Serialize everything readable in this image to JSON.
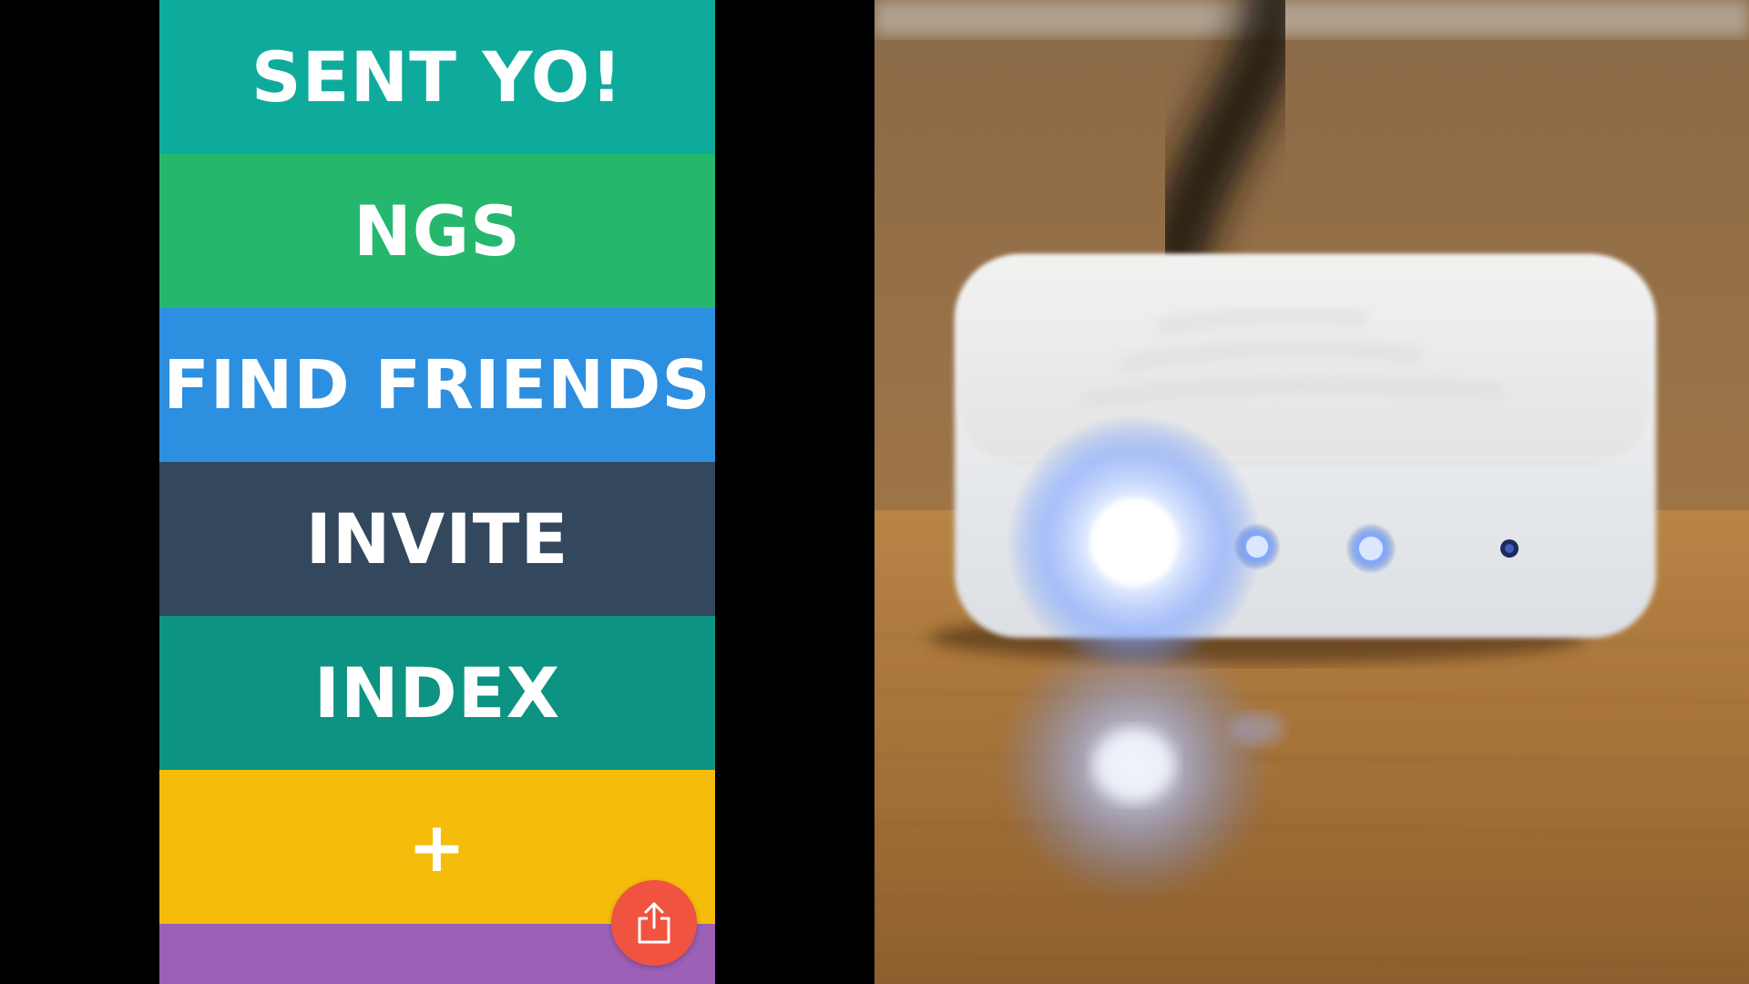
{
  "app": {
    "rows": [
      {
        "label": "SENT YO!",
        "color": "#0eab9c"
      },
      {
        "label": "NGS",
        "color": "#25b86d"
      },
      {
        "label": "FIND FRIENDS",
        "color": "#2c8fe0"
      },
      {
        "label": "INVITE",
        "color": "#33475d"
      },
      {
        "label": "INDEX",
        "color": "#0d9381"
      },
      {
        "label": "+",
        "color": "#f6bc0b"
      },
      {
        "label": "",
        "color": "#9c60b6"
      }
    ],
    "share_button": {
      "icon": "share-icon",
      "color": "#f0533f"
    }
  },
  "photo": {
    "subject": "white-device-with-blue-led",
    "led_color": "#5b8cff",
    "table_color": "#a0703a"
  }
}
